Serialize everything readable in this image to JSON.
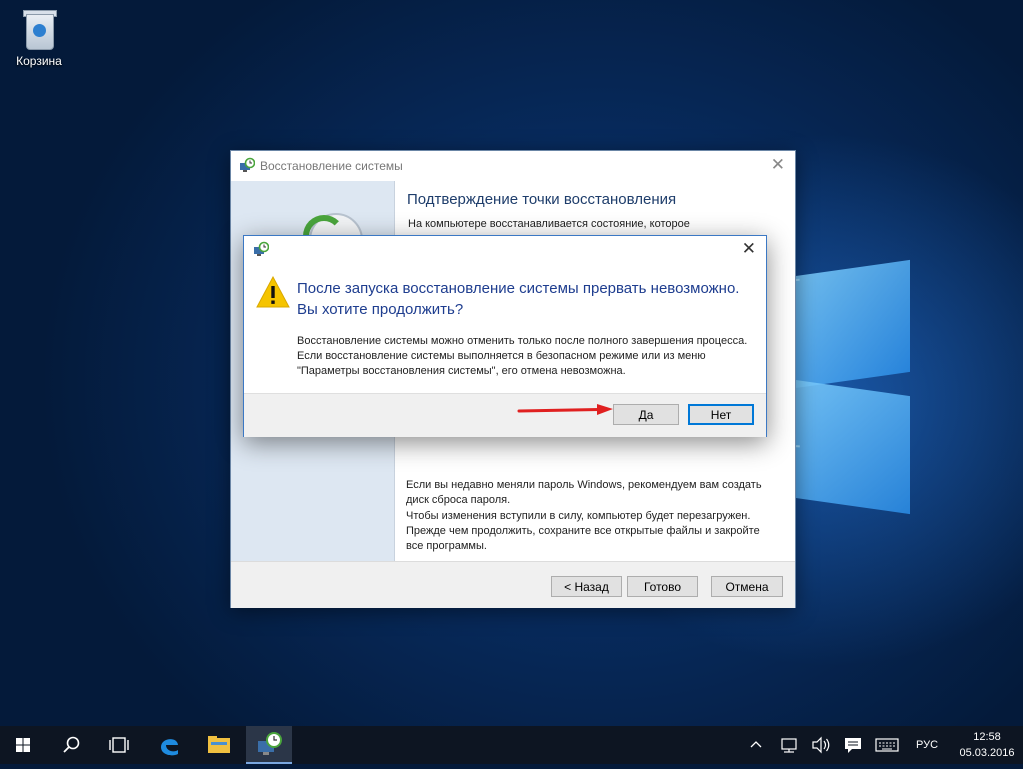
{
  "desktop": {
    "recycle_bin_label": "Корзина"
  },
  "wizard": {
    "title": "Восстановление системы",
    "heading": "Подтверждение точки восстановления",
    "intro": "На компьютере восстанавливается состояние, которое",
    "note_password": "Если вы недавно меняли пароль Windows, рекомендуем вам создать диск сброса пароля.",
    "note_restart": "Чтобы изменения вступили в силу, компьютер будет перезагружен. Прежде чем продолжить, сохраните все открытые файлы и закройте все программы.",
    "buttons": {
      "back": "< Назад",
      "finish": "Готово",
      "cancel": "Отмена"
    },
    "close_glyph": "✕"
  },
  "dialog": {
    "main_text": "После запуска восстановление системы прервать невозможно. Вы хотите продолжить?",
    "body_text": "Восстановление системы можно отменить только после полного завершения процесса. Если восстановление системы выполняется в безопасном режиме или из меню \"Параметры восстановления системы\", его отмена невозможна.",
    "buttons": {
      "yes": "Да",
      "no": "Нет"
    },
    "close_glyph": "✕"
  },
  "taskbar": {
    "icons": [
      "windows-start-icon",
      "search-icon",
      "task-view-icon",
      "edge-browser-icon",
      "file-explorer-icon",
      "system-restore-app-icon"
    ],
    "language": "РУС",
    "time": "12:58",
    "date": "05.03.2016"
  },
  "colors": {
    "accent_blue": "#3b78c4",
    "dialog_text_blue": "#1e3d8f",
    "warning_yellow": "#f5c400",
    "arrow_red": "#e02020"
  }
}
